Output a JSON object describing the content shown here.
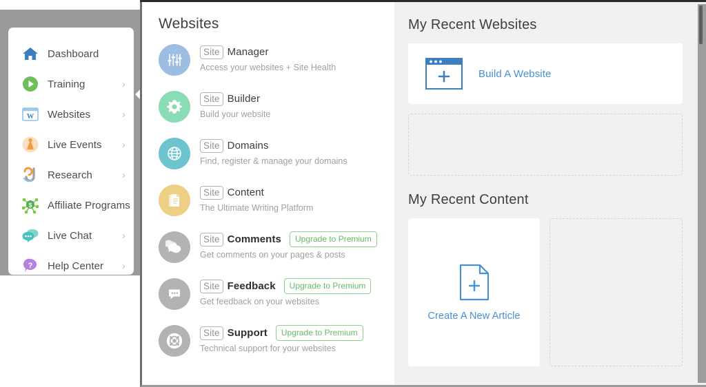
{
  "sidebar": {
    "items": [
      {
        "label": "Dashboard",
        "icon": "home-icon",
        "has_chevron": false
      },
      {
        "label": "Training",
        "icon": "play-circle-icon",
        "has_chevron": true
      },
      {
        "label": "Websites",
        "icon": "wordpress-window-icon",
        "has_chevron": true
      },
      {
        "label": "Live Events",
        "icon": "broadcast-icon",
        "has_chevron": true
      },
      {
        "label": "Research",
        "icon": "jaaxy-research-icon",
        "has_chevron": true
      },
      {
        "label": "Affiliate Programs",
        "icon": "affiliate-network-icon",
        "has_chevron": false
      },
      {
        "label": "Live Chat",
        "icon": "chat-bubbles-icon",
        "has_chevron": true
      },
      {
        "label": "Help Center",
        "icon": "question-bubble-icon",
        "has_chevron": true
      }
    ],
    "chevron_glyph": "›",
    "collapse_arrow_icon": "caret-left-icon"
  },
  "flyout": {
    "title": "Websites",
    "site_badge": "Site",
    "services": [
      {
        "badge": "Site",
        "name": "Manager",
        "desc": "Access your websites + Site Health",
        "icon": "sliders-icon",
        "circle_color": "#9dbde3",
        "upgrade": null,
        "bold": false
      },
      {
        "badge": "Site",
        "name": "Builder",
        "desc": "Build your website",
        "icon": "gear-icon",
        "circle_color": "#89dcb4",
        "upgrade": null,
        "bold": false
      },
      {
        "badge": "Site",
        "name": "Domains",
        "desc": "Find, register & manage your domains",
        "icon": "globe-icon",
        "circle_color": "#6ec4ce",
        "upgrade": null,
        "bold": false
      },
      {
        "badge": "Site",
        "name": "Content",
        "desc": "The Ultimate Writing Platform",
        "icon": "document-stack-icon",
        "circle_color": "#eecf86",
        "upgrade": null,
        "bold": false
      },
      {
        "badge": "Site",
        "name": "Comments",
        "desc": "Get comments on your pages & posts",
        "icon": "comment-bubbles-icon",
        "circle_color": "#b3b3b3",
        "upgrade": "Upgrade to Premium",
        "bold": true
      },
      {
        "badge": "Site",
        "name": "Feedback",
        "desc": "Get feedback on your websites",
        "icon": "feedback-bubble-icon",
        "circle_color": "#b3b3b3",
        "upgrade": "Upgrade to Premium",
        "bold": true
      },
      {
        "badge": "Site",
        "name": "Support",
        "desc": "Technical support for your websites",
        "icon": "lifebuoy-icon",
        "circle_color": "#b3b3b3",
        "upgrade": "Upgrade to Premium",
        "bold": true
      }
    ]
  },
  "recent_websites": {
    "title": "My Recent Websites",
    "build_label": "Build A Website",
    "build_icon": "browser-plus-icon",
    "empty_slot": ""
  },
  "recent_content": {
    "title": "My Recent Content",
    "create_label": "Create A New Article",
    "create_icon": "document-plus-icon",
    "empty_slot": ""
  },
  "colors": {
    "link_blue": "#4a8fd0",
    "upgrade_green": "#66bb66",
    "panel_bg": "#f1f1f1",
    "rail_gray": "#9a9a9a"
  }
}
